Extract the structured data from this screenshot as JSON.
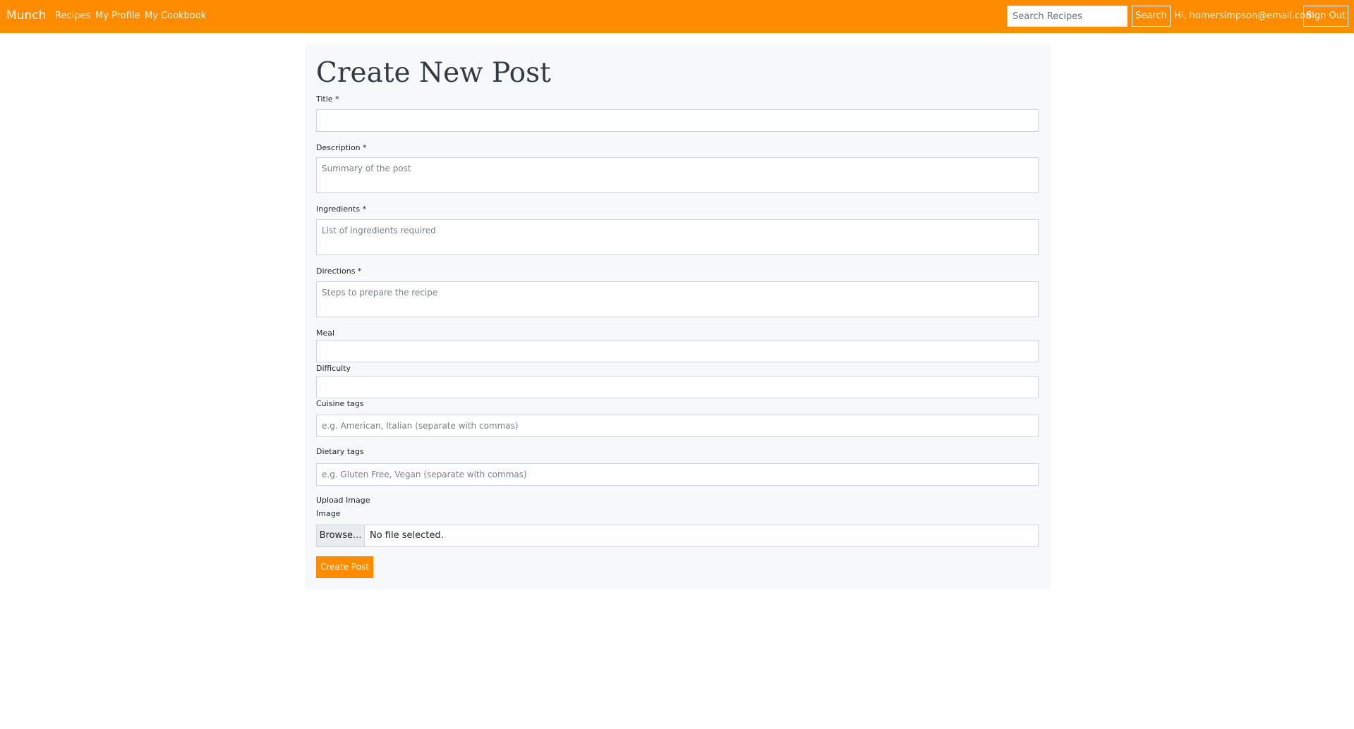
{
  "navbar": {
    "brand": "Munch",
    "links": [
      "Recipes",
      "My Profile",
      "My Cookbook"
    ],
    "search": {
      "placeholder": "Search Recipes",
      "value": "",
      "button_label": "Search"
    },
    "greeting": "Hi, homersimpson@email.com",
    "signout_label": "Sign Out",
    "color": "#ff8c00"
  },
  "form": {
    "heading": "Create New Post",
    "title": {
      "label": "Title *",
      "value": ""
    },
    "description": {
      "label": "Description *",
      "placeholder": "Summary of the post",
      "value": ""
    },
    "ingredients": {
      "label": "Ingredients *",
      "placeholder": "List of ingredients required",
      "value": ""
    },
    "directions": {
      "label": "Directions *",
      "placeholder": "Steps to prepare the recipe",
      "value": ""
    },
    "meal": {
      "label": "Meal",
      "value": ""
    },
    "difficulty": {
      "label": "Difficulty",
      "value": ""
    },
    "cuisine_tags": {
      "label": "Cuisine tags",
      "placeholder": "e.g. American, Italian (separate with commas)",
      "value": ""
    },
    "dietary_tags": {
      "label": "Dietary tags",
      "placeholder": "e.g. Gluten Free, Vegan (separate with commas)",
      "value": ""
    },
    "upload": {
      "section_label": "Upload Image",
      "label": "Image",
      "browse_label": "Browse...",
      "status": "No file selected."
    },
    "submit_label": "Create Post"
  }
}
